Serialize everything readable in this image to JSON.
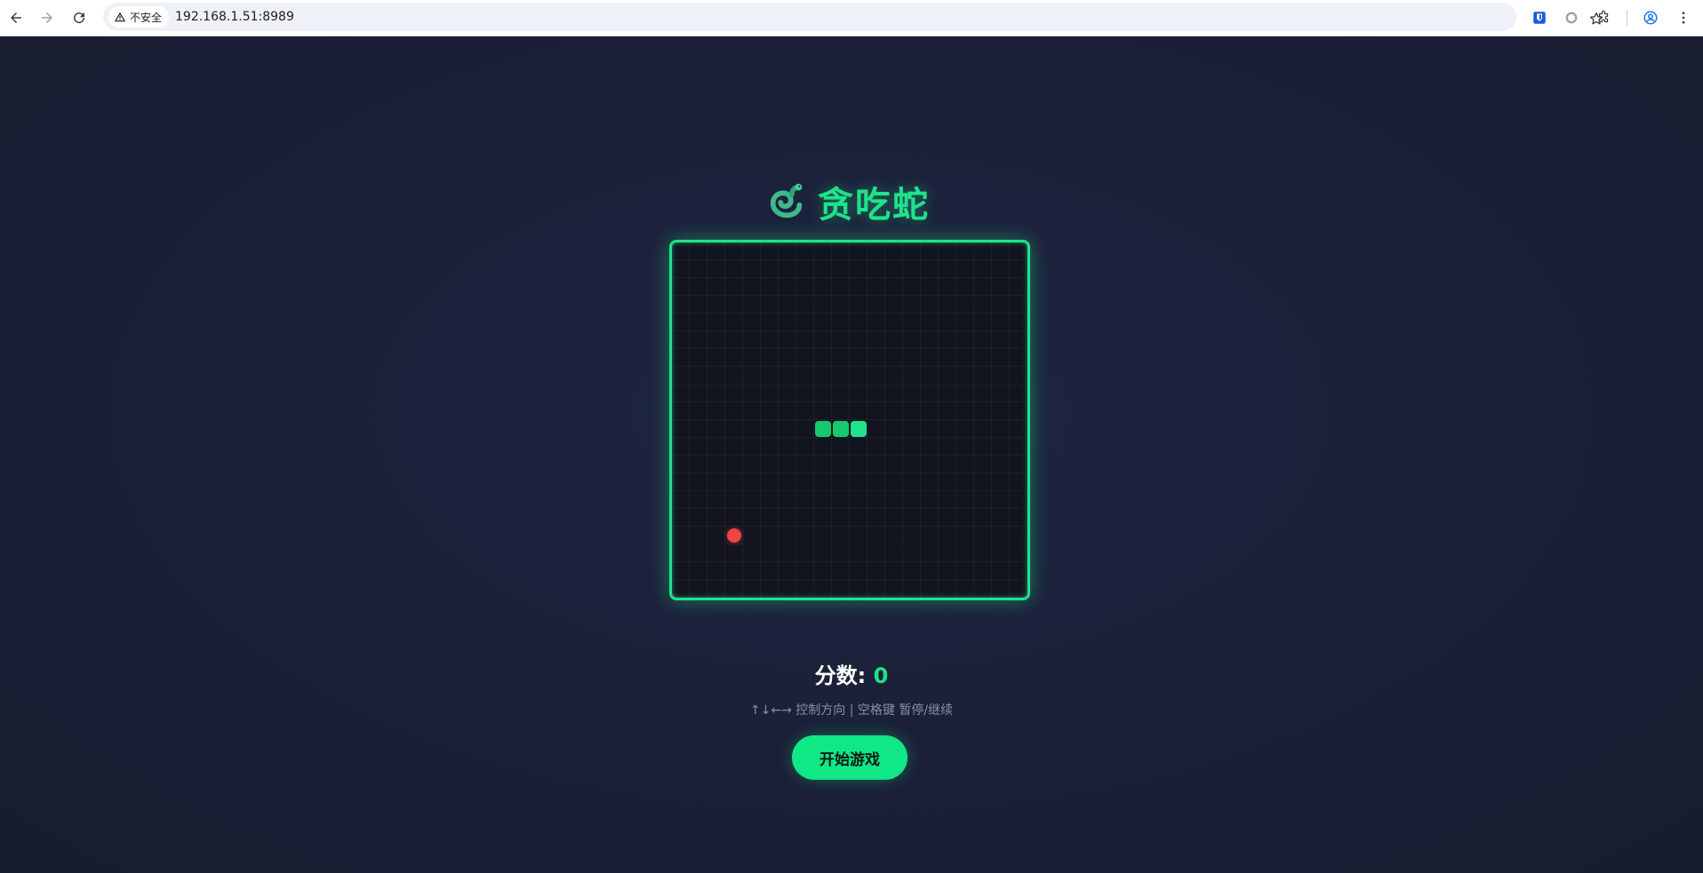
{
  "browser": {
    "security_label": "不安全",
    "url": "192.168.1.51:8989"
  },
  "game": {
    "title": "贪吃蛇",
    "score_label": "分数:",
    "score": "0",
    "hint": "↑↓←→ 控制方向 | 空格键 暂停/继续",
    "start_button": "开始游戏"
  },
  "colors": {
    "accent": "#1ee38a",
    "food": "#ef4444",
    "background": "#1b2038",
    "board": "#121420"
  }
}
